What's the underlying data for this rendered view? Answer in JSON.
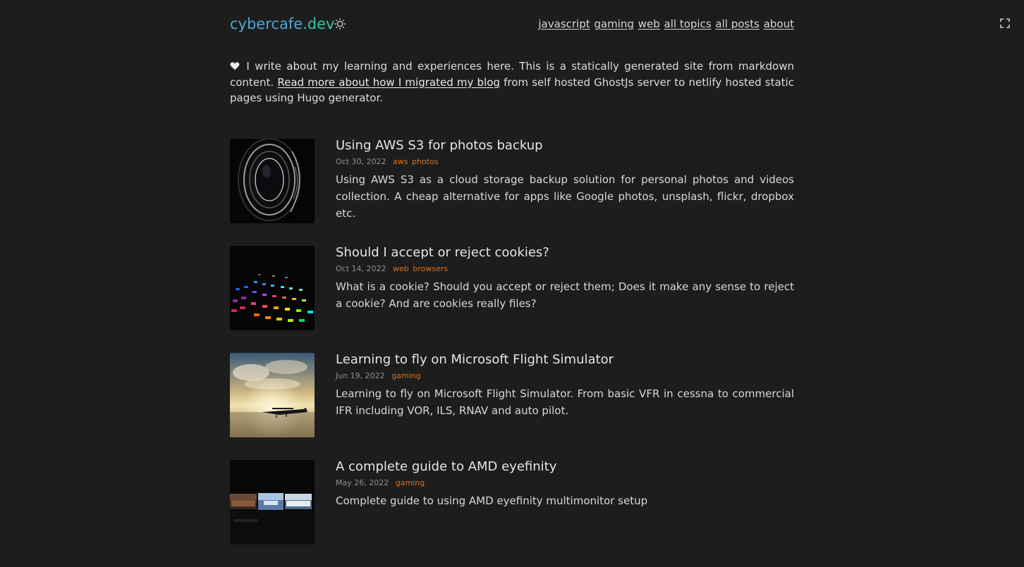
{
  "site": {
    "logo_main": "cybercafe",
    "logo_suffix": ".dev",
    "colors": {
      "background": "#1d1d1d",
      "logo_blue": "#4aa8d8",
      "logo_green": "#36c3a6",
      "tag_orange": "#d7741c"
    }
  },
  "nav": {
    "items": [
      {
        "label": "javascript"
      },
      {
        "label": "gaming"
      },
      {
        "label": "web"
      },
      {
        "label": "all topics"
      },
      {
        "label": "all posts"
      },
      {
        "label": "about"
      }
    ]
  },
  "icons": {
    "theme_toggle": "sun-icon",
    "fullscreen": "fullscreen-icon",
    "heart": "heart-icon"
  },
  "intro": {
    "text_before": "I write about my learning and experiences here. This is a statically generated site from markdown content.",
    "link_text": "Read more about how I migrated my blog",
    "text_after": "from self hosted GhostJs server to netlify hosted static pages using Hugo generator."
  },
  "posts": [
    {
      "title": "Using AWS S3 for photos backup",
      "date": "Oct 30, 2022",
      "tags": [
        "aws",
        "photos"
      ],
      "excerpt": "Using AWS S3 as a cloud storage backup solution for personal photos and videos collection. A cheap alternative for apps like Google photos, unsplash, flickr, dropbox etc."
    },
    {
      "title": "Should I accept or reject cookies?",
      "date": "Oct 14, 2022",
      "tags": [
        "web",
        "browsers"
      ],
      "excerpt": "What is a cookie? Should you accept or reject them; Does it make any sense to reject a cookie? And are cookies really files?"
    },
    {
      "title": "Learning to fly on Microsoft Flight Simulator",
      "date": "Jun 19, 2022",
      "tags": [
        "gaming"
      ],
      "excerpt": "Learning to fly on Microsoft Flight Simulator. From basic VFR in cessna to commercial IFR including VOR, ILS, RNAV and auto pilot."
    },
    {
      "title": "A complete guide to AMD eyefinity",
      "date": "May 26, 2022",
      "tags": [
        "gaming"
      ],
      "excerpt": "Complete guide to using AMD eyefinity multimonitor setup"
    }
  ]
}
